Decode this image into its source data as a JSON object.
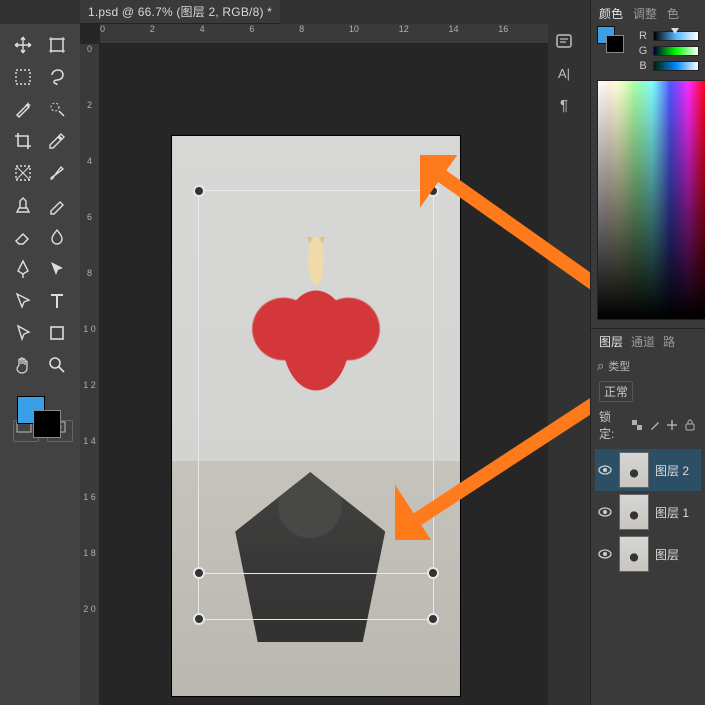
{
  "document": {
    "tab_title": "1.psd @ 66.7% (图层 2, RGB/8) *"
  },
  "rulers": {
    "h": [
      "0",
      "2",
      "4",
      "6",
      "8",
      "10",
      "12",
      "14",
      "16"
    ],
    "v": [
      "0",
      "2",
      "4",
      "6",
      "8",
      "1 0",
      "1 2",
      "1 4",
      "1 6",
      "1 8",
      "2 0"
    ]
  },
  "swatch": {
    "fg": "#39a0e8",
    "bg": "#000000"
  },
  "rightcol": {
    "typo_label": "A|",
    "para_label": "¶"
  },
  "color_panel": {
    "tab_color": "颜色",
    "tab_adjust": "调整",
    "tab_swatch": "色",
    "channels": {
      "r": "R",
      "g": "G",
      "b": "B"
    }
  },
  "layer_panel": {
    "tab_layers": "图层",
    "tab_channels": "通道",
    "tab_paths": "路",
    "filter_label": "类型",
    "search_glyph": "⌕",
    "blend_mode": "正常",
    "lock_label": "锁定:",
    "layers": [
      {
        "name": "图层 2",
        "visible": true,
        "active": true,
        "transparent": false
      },
      {
        "name": "图层 1",
        "visible": true,
        "active": false,
        "transparent": true
      },
      {
        "name": "图层",
        "visible": true,
        "active": false,
        "transparent": false
      }
    ]
  },
  "tools": [
    "move-tool",
    "artboard-tool",
    "marquee-tool",
    "lasso-tool",
    "wand-tool",
    "quick-select-tool",
    "crop-tool",
    "eyedropper-tool",
    "frame-tool",
    "brush-tool",
    "clone-tool",
    "pencil-tool",
    "eraser-tool",
    "blur-tool",
    "pen-tool",
    "path-select-tool",
    "direct-select-tool",
    "type-tool",
    "pointer-tool",
    "shape-tool",
    "hand-tool",
    "zoom-tool"
  ]
}
